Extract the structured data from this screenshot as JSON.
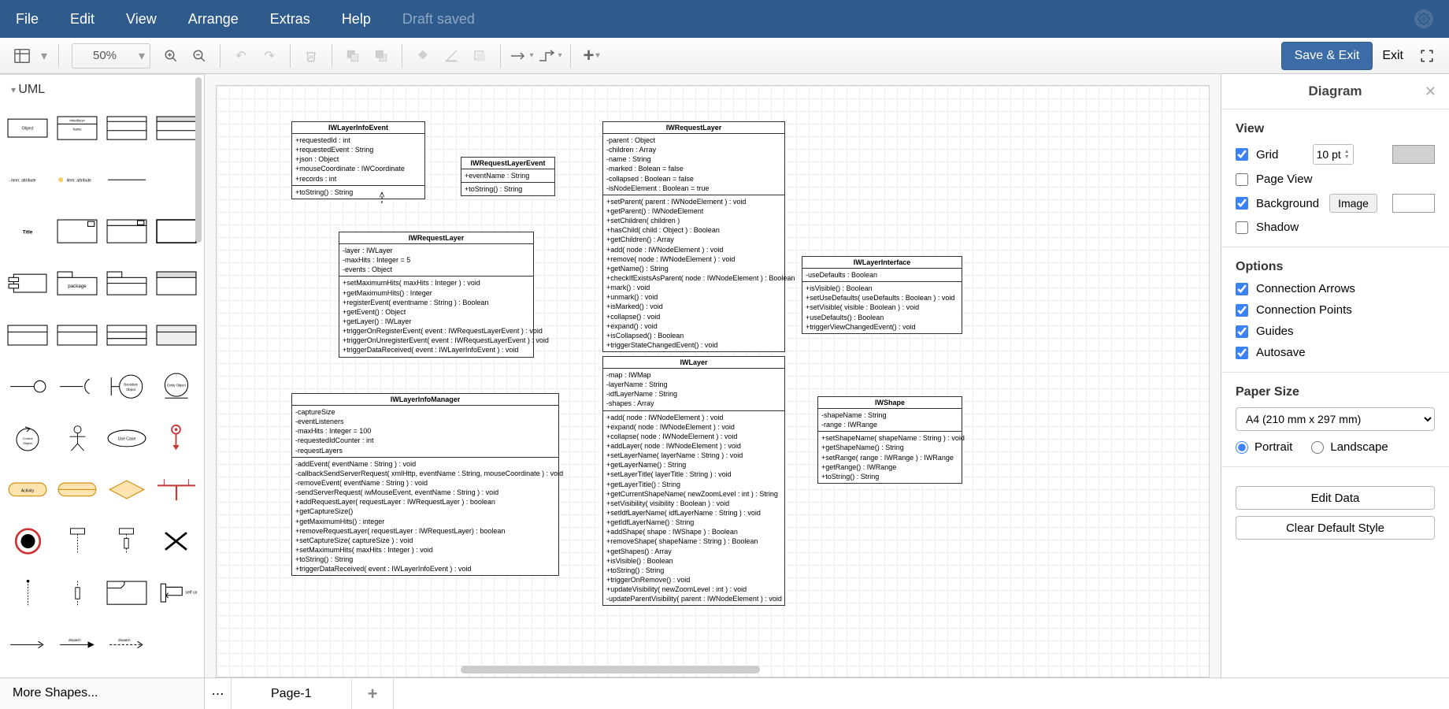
{
  "menu": {
    "items": [
      "File",
      "Edit",
      "View",
      "Arrange",
      "Extras",
      "Help"
    ],
    "draft": "Draft saved"
  },
  "toolbar": {
    "zoom": "50%",
    "save_exit": "Save & Exit",
    "exit": "Exit"
  },
  "left_panel": {
    "category": "UML",
    "more_shapes": "More Shapes..."
  },
  "tabs": {
    "page1": "Page-1"
  },
  "right_panel": {
    "title": "Diagram",
    "view_h": "View",
    "grid": "Grid",
    "grid_val": "10 pt",
    "page_view": "Page View",
    "background": "Background",
    "image_btn": "Image",
    "shadow": "Shadow",
    "options_h": "Options",
    "conn_arrows": "Connection Arrows",
    "conn_points": "Connection Points",
    "guides": "Guides",
    "autosave": "Autosave",
    "paper_h": "Paper Size",
    "paper_size": "A4 (210 mm x 297 mm)",
    "portrait": "Portrait",
    "landscape": "Landscape",
    "edit_data": "Edit Data",
    "clear_style": "Clear Default Style"
  },
  "uml_classes": {
    "layerInfoEvent": {
      "title": "IWLayerInfoEvent",
      "attrs": [
        "+requestedId : int",
        "+requestedEvent : String",
        "+json : Object",
        "+mouseCoordinate : IWCoordinate",
        "+records : int"
      ],
      "ops": [
        "+toString() : String"
      ]
    },
    "requestLayerEvent": {
      "title": "IWRequestLayerEvent",
      "attrs": [
        "+eventName : String"
      ],
      "ops": [
        "+toString() : String"
      ]
    },
    "requestLayerNode": {
      "title": "IWRequestLayer",
      "attrs": [
        "-parent : Object",
        "-children : Array",
        "-name : String",
        "-marked : Bolean = false",
        "-collapsed : Boolean = false",
        "-isNodeElement : Boolean = true"
      ],
      "ops": [
        "+setParent( parent : IWNodeElement ) : void",
        "+getParent() : IWNodeElement",
        "+setChildren( children )",
        "+hasChild( child : Object ) : Boolean",
        "+getChildren() : Array",
        "+add( node : IWNodeElement ) : void",
        "+remove( node : IWNodeElement ) : void",
        "+getName() : String",
        "+checkIfExistsAsParent( node : IWNodeElement ) : Boolean",
        "+mark() : void",
        "+unmark() : void",
        "+isMarked() : void",
        "+collapse() : void",
        "+expand() : void",
        "+isCollapsed() : Boolean",
        "+triggerStateChangedEvent() : void"
      ]
    },
    "requestLayer": {
      "title": "IWRequestLayer",
      "attrs": [
        "-layer : IWLayer",
        "-maxHits : Integer = 5",
        "-events : Object"
      ],
      "ops": [
        "+setMaximumHits( maxHits : Integer ) : void",
        "+getMaximumHits() : Integer",
        "+registerEvent( eventname : String ) : Boolean",
        "+getEvent() : Object",
        "+getLayer() : IWLayer",
        "+triggerOnRegisterEvent( event : IWRequestLayerEvent ) : void",
        "+triggerOnUnregisterEvent( event : IWRequestLayerEvent ) : void",
        "+triggerDataReceived( event : IWLayerInfoEvent ) : void"
      ]
    },
    "layerInterface": {
      "title": "IWLayerInterface",
      "attrs": [
        "-useDefaults : Boolean"
      ],
      "ops": [
        "+isVisible() : Boolean",
        "+setUseDefaults( useDefaults : Boolean ) : void",
        "+setVisible( visible : Boolean ) : void",
        "+useDefaults() : Boolean",
        "+triggerViewChangedEvent() : void"
      ]
    },
    "layerInfoManager": {
      "title": "IWLayerInfoManager",
      "attrs": [
        "-captureSize",
        "-eventListeners",
        "-maxHits : Integer = 100",
        "-requestedIdCounter : int",
        "-requestLayers"
      ],
      "ops": [
        "-addEvent( eventName : String ) : void",
        "-callbackSendServerRequest( xmlHttp, eventName : String, mouseCoordinate ) : void",
        "-removeEvent( eventName : String ) : void",
        "-sendServerRequest( iwMouseEvent, eventName : String ) : void",
        "+addRequestLayer( requestLayer : IWRequestLayer ) : boolean",
        "+getCaptureSize()",
        "+getMaximumHits() : integer",
        "+removeRequestLayer( requestLayer : IWRequestLayer) : boolean",
        "+setCaptureSize( captureSize ) : void",
        "+setMaximumHits( maxHits : Integer ) : void",
        "+toString() : String",
        "+triggerDataReceived( event : IWLayerInfoEvent ) : void"
      ]
    },
    "layer": {
      "title": "IWLayer",
      "attrs": [
        "-map : IWMap",
        "-layerName : String",
        "-idfLayerName : String",
        "-shapes : Array"
      ],
      "ops": [
        "+add( node : IWNodeElement ) : void",
        "+expand( node : IWNodeElement ) : void",
        "+collapse( node : IWNodeElement ) : void",
        "+addLayer( node : IWNodeElement ) : void",
        "+setLayerName( layerName : String ) : void",
        "+getLayerName() : String",
        "+setLayerTitle( layerTitle : String ) : void",
        "+getLayerTitle() : String",
        "+getCurrentShapeName( newZoomLevel : int ) : String",
        "+setVisibility( visibility : Boolean ) : void",
        "+setIdfLayerName( idfLayerName : String ) : void",
        "+getIdfLayerName() : String",
        "+addShape( shape : IWShape ) : Boolean",
        "+removeShape( shapeName : String ) : Boolean",
        "+getShapes() : Array",
        "+isVisible() : Boolean",
        "+toString() : String",
        "+triggerOnRemove() : void",
        "+updateVisibility( newZoomLevel : int ) : void",
        "-updateParentVisibility( parent : IWNodeElement ) : void"
      ]
    },
    "shape": {
      "title": "IWShape",
      "attrs": [
        "-shapeName : String",
        "-range : IWRange"
      ],
      "ops": [
        "+setShapeName( shapeName : String ) : void",
        "+getShapeName() : String",
        "+setRange( range : IWRange ) : IWRange",
        "+getRange() : IWRange",
        "+toString() : String"
      ]
    }
  },
  "labels": {
    "request": "request",
    "one": "1"
  }
}
